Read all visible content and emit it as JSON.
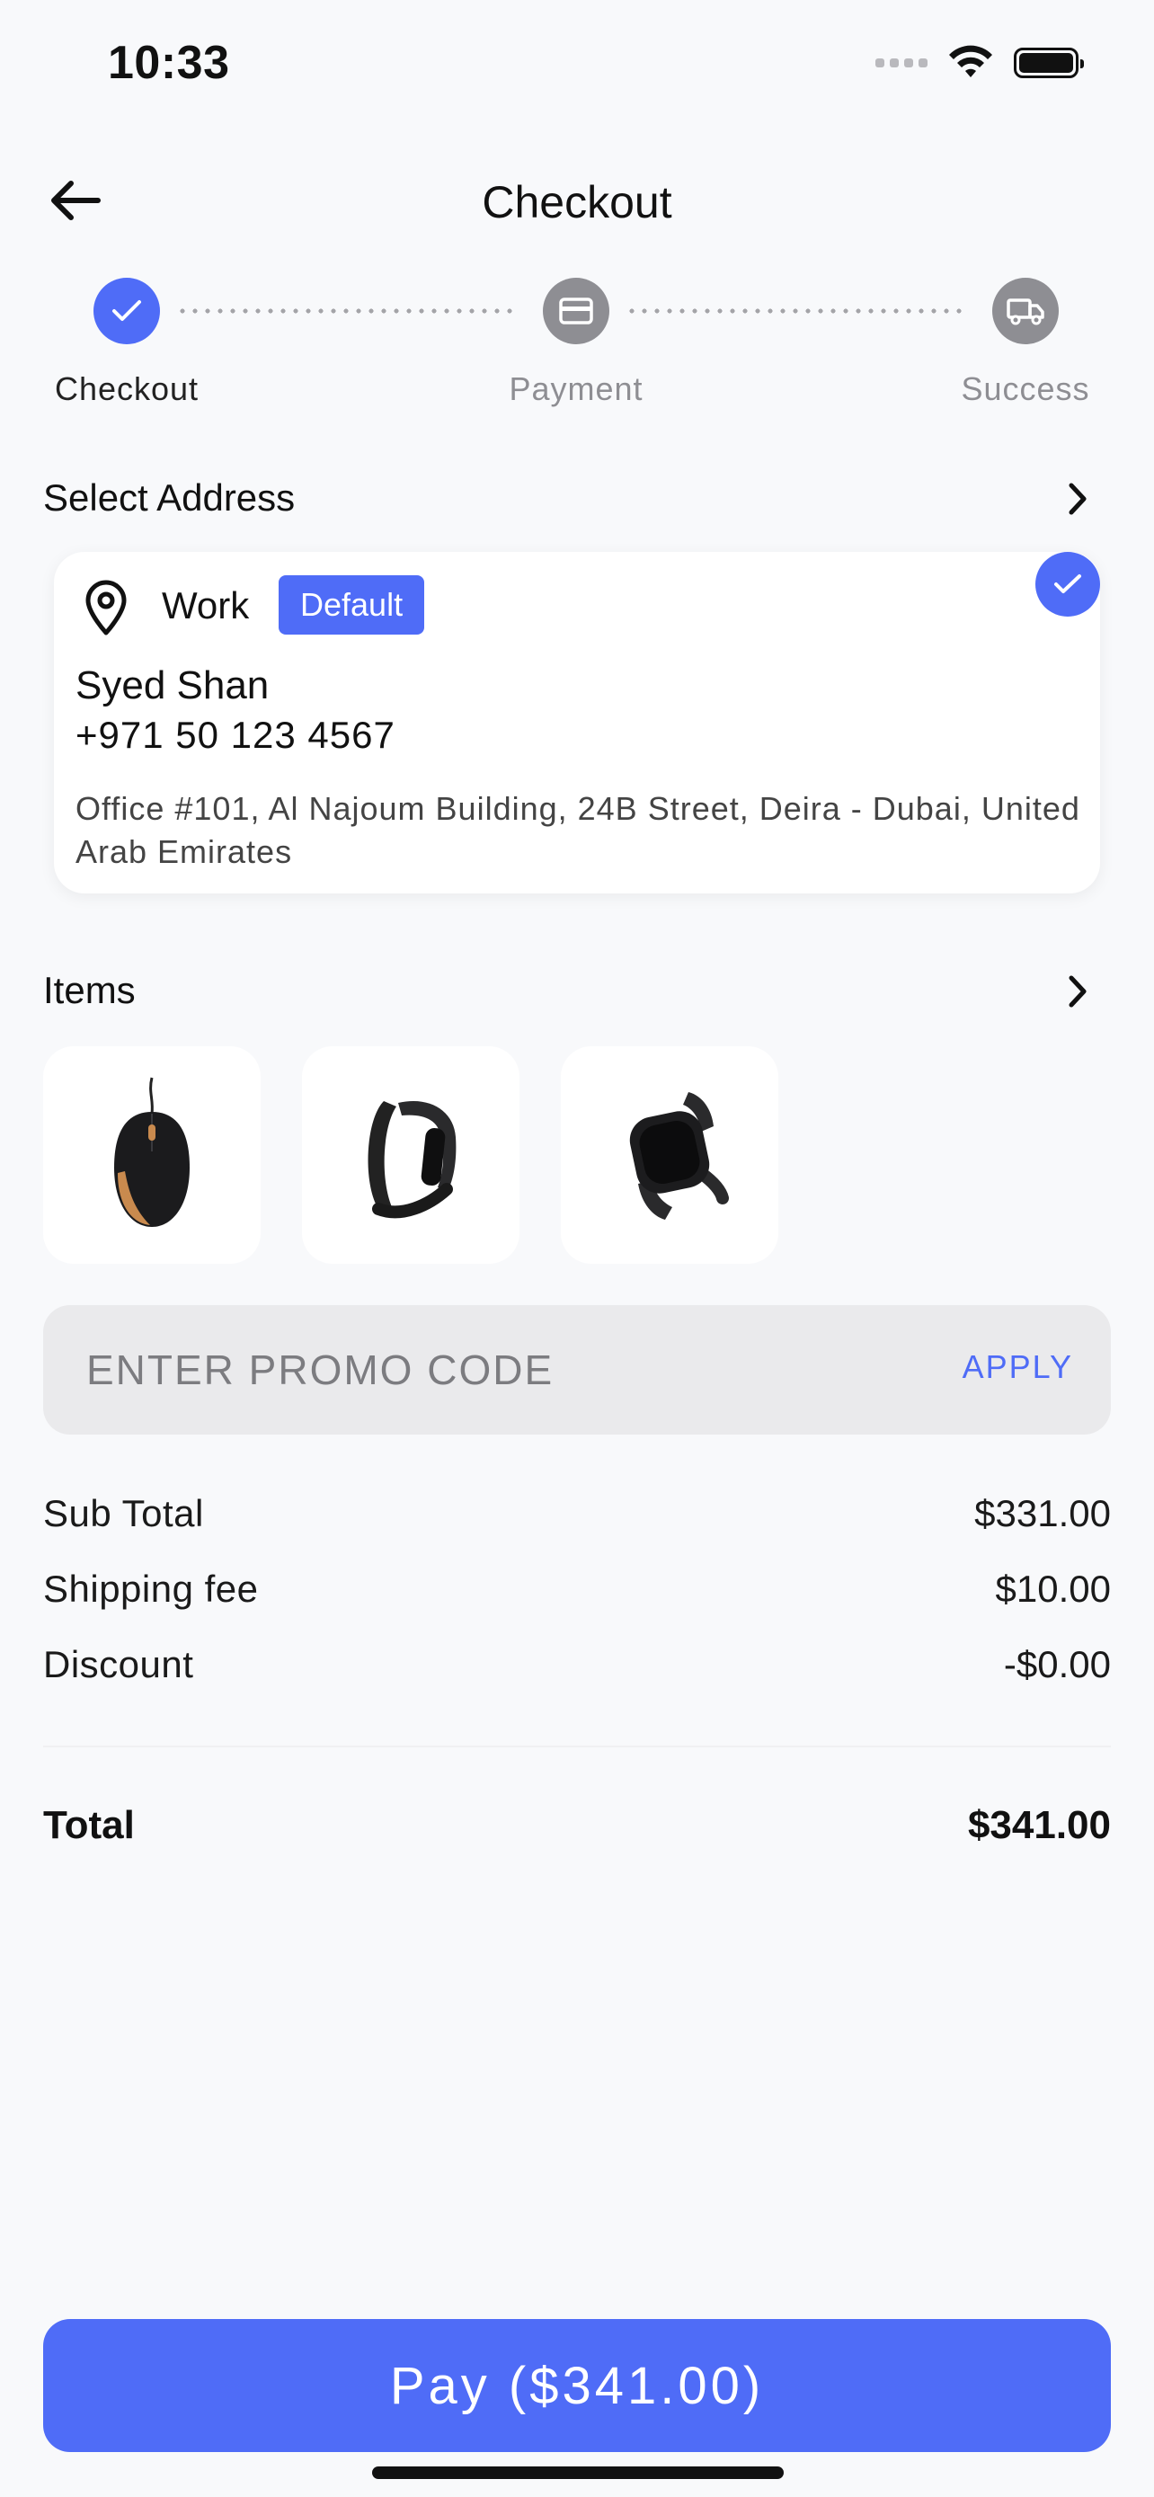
{
  "status_bar": {
    "time": "10:33"
  },
  "header": {
    "title": "Checkout"
  },
  "stepper": {
    "steps": [
      {
        "label": "Checkout",
        "state": "complete"
      },
      {
        "label": "Payment",
        "state": "pending"
      },
      {
        "label": "Success",
        "state": "pending"
      }
    ]
  },
  "address": {
    "section_title": "Select Address",
    "type": "Work",
    "badge": "Default",
    "name": "Syed Shan",
    "phone": "+971 50 123 4567",
    "line": "Office #101, Al Najoum Building, 24B Street, Deira - Dubai, United Arab Emirates"
  },
  "items": {
    "section_title": "Items",
    "list": [
      {
        "icon": "mouse-icon"
      },
      {
        "icon": "fitness-band-icon"
      },
      {
        "icon": "smartwatch-icon"
      }
    ]
  },
  "promo": {
    "placeholder": "ENTER PROMO CODE",
    "apply_label": "APPLY"
  },
  "summary": {
    "subtotal_label": "Sub Total",
    "subtotal_value": "$331.00",
    "shipping_label": "Shipping fee",
    "shipping_value": "$10.00",
    "discount_label": "Discount",
    "discount_value": "-$0.00",
    "total_label": "Total",
    "total_value": "$341.00"
  },
  "pay_button": {
    "label": "Pay ($341.00)"
  },
  "colors": {
    "accent": "#4f6cf7",
    "inactive": "#8e8e93",
    "background": "#f8f9fb"
  }
}
